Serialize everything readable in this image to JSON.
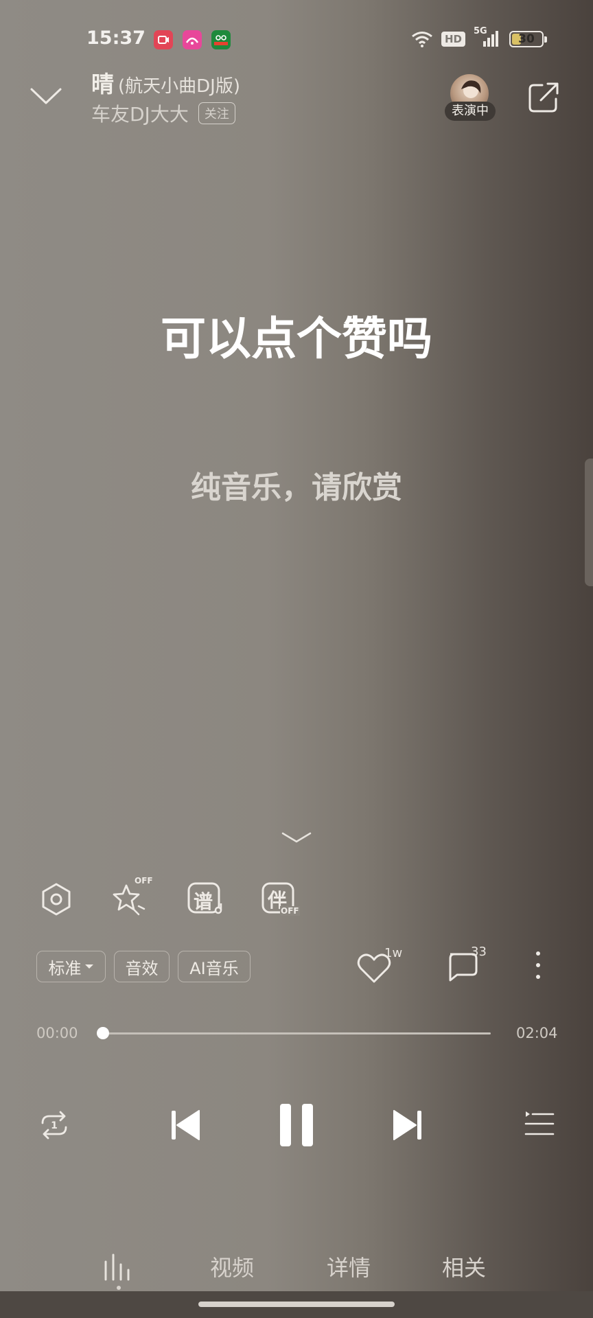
{
  "status_bar": {
    "time": "15:37",
    "network": "5G",
    "hd": "HD",
    "battery": "30",
    "battery_level": 0.3,
    "app_icons": [
      "video-app-icon",
      "pink-app-icon",
      "oppo-app-icon"
    ]
  },
  "header": {
    "song_title": "晴",
    "song_version": "(航天小曲DJ版)",
    "artist": "车友DJ大大",
    "follow_label": "关注",
    "performing_label": "表演中"
  },
  "lyrics": {
    "main": "可以点个赞吗",
    "sub": "纯音乐，请欣赏"
  },
  "tools": {
    "off_label": "OFF",
    "score_char": "谱",
    "accompany_char": "伴"
  },
  "controls": {
    "quality_label": "标准",
    "effects_label": "音效",
    "ai_label": "AI音乐",
    "like_count": "1w",
    "comment_count": "33"
  },
  "progress": {
    "current": "00:00",
    "total": "02:04",
    "fraction": 0.0
  },
  "tabs": [
    {
      "label": ""
    },
    {
      "label": "视频"
    },
    {
      "label": "详情"
    },
    {
      "label": "相关"
    }
  ],
  "colors": {
    "background": "#8c8780",
    "battery": "#d9c165",
    "text": "#ffffff"
  }
}
